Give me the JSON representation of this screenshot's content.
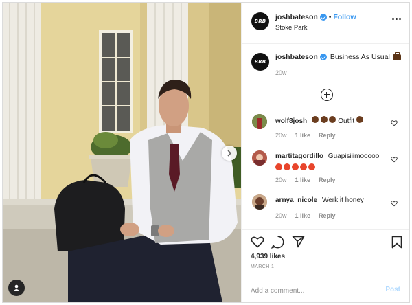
{
  "post": {
    "username": "joshbateson",
    "follow_label": "Follow",
    "separator": "•",
    "location": "Stoke Park",
    "avatar_text": "BRB"
  },
  "caption": {
    "username": "joshbateson",
    "text": "Business As Usual",
    "time": "20w"
  },
  "comments": [
    {
      "username": "wolf8josh",
      "text": "Outfit",
      "time": "20w",
      "likes": "1 like",
      "reply": "Reply"
    },
    {
      "username": "martitagordillo",
      "text": "Guapisiiimooooo",
      "time": "20w",
      "likes": "1 like",
      "reply": "Reply"
    },
    {
      "username": "arnya_nicole",
      "text": "Werk it honey",
      "time": "20w",
      "likes": "1 like",
      "reply": "Reply"
    }
  ],
  "actions": {
    "likes": "4,939 likes",
    "date": "MARCH 1"
  },
  "add_comment": {
    "placeholder": "Add a comment...",
    "post_label": "Post"
  },
  "colors": {
    "link_blue": "#3897f0",
    "muted_gray": "#8e8e8e",
    "post_disabled": "#b3dbff"
  }
}
